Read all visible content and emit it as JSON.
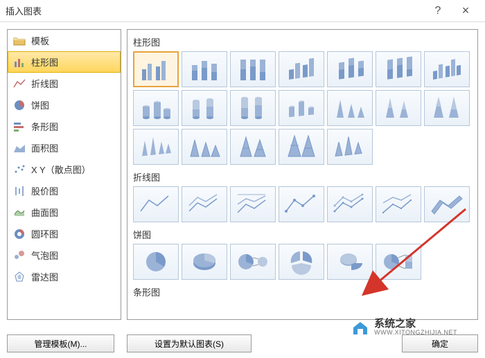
{
  "dialog": {
    "title": "插入图表",
    "help": "?",
    "close": "×"
  },
  "sidebar": {
    "items": [
      {
        "label": "模板",
        "icon": "folder"
      },
      {
        "label": "柱形图",
        "icon": "bar"
      },
      {
        "label": "折线图",
        "icon": "line"
      },
      {
        "label": "饼图",
        "icon": "pie"
      },
      {
        "label": "条形图",
        "icon": "hbar"
      },
      {
        "label": "面积图",
        "icon": "area"
      },
      {
        "label": "X Y（散点图）",
        "icon": "scatter"
      },
      {
        "label": "股价图",
        "icon": "stock"
      },
      {
        "label": "曲面图",
        "icon": "surface"
      },
      {
        "label": "圆环图",
        "icon": "donut"
      },
      {
        "label": "气泡图",
        "icon": "bubble"
      },
      {
        "label": "雷达图",
        "icon": "radar"
      }
    ],
    "selected_index": 1
  },
  "gallery": {
    "sections": [
      {
        "title": "柱形图",
        "key": "column"
      },
      {
        "title": "折线图",
        "key": "line"
      },
      {
        "title": "饼图",
        "key": "pie"
      },
      {
        "title": "条形图",
        "key": "bar"
      }
    ],
    "selected_thumb": 0
  },
  "footer": {
    "manage_templates": "管理模板(M)...",
    "set_default": "设置为默认图表(S)",
    "ok": "确定"
  },
  "watermark": {
    "main": "系统之家",
    "sub": "WWW.XITONGZHIJIA.NET"
  }
}
